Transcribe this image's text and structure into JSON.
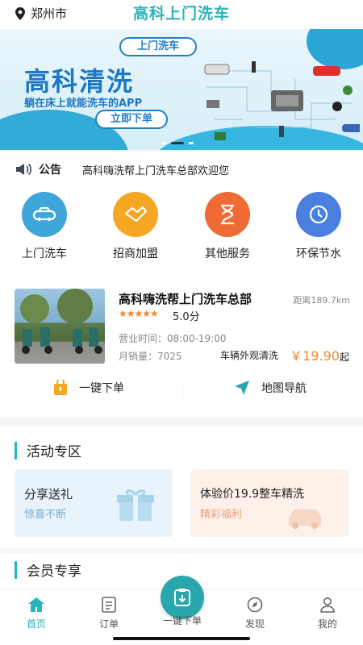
{
  "header": {
    "location": "郑州市",
    "title": "高科上门洗车"
  },
  "banner": {
    "tag": "上门洗车",
    "title": "高科清洗",
    "subtitle": "躺在床上就能洗车的APP",
    "cta": "立即下单"
  },
  "notice": {
    "label": "公告",
    "text": "高科嗨洗帮上门洗车总部欢迎您"
  },
  "quick_menu": [
    {
      "label": "上门洗车",
      "icon": "car-icon",
      "color": "#3fa6d9"
    },
    {
      "label": "招商加盟",
      "icon": "handshake-icon",
      "color": "#f5a623"
    },
    {
      "label": "其他服务",
      "icon": "hourglass-icon",
      "color": "#f06a35"
    },
    {
      "label": "环保节水",
      "icon": "clock-icon",
      "color": "#4a7fe0"
    }
  ],
  "store": {
    "name": "高科嗨洗帮上门洗车总部",
    "distance": "距离189.7km",
    "rating_stars": 5,
    "rating": "5.0分",
    "hours": "营业时间：08:00-19:00",
    "sales": "月销量：7025",
    "service": "车辆外观清洗",
    "price": "￥19.90",
    "price_suffix": "起"
  },
  "store_actions": {
    "order": "一键下单",
    "navigate": "地图导航"
  },
  "activity": {
    "title": "活动专区",
    "cards": [
      {
        "title": "分享送礼",
        "subtitle": "惊喜不断"
      },
      {
        "title": "体验价19.9整车精洗",
        "subtitle": "精彩福利"
      }
    ]
  },
  "member": {
    "title": "会员专享"
  },
  "tabbar": [
    {
      "label": "首页",
      "icon": "home-icon",
      "active": true
    },
    {
      "label": "订单",
      "icon": "order-icon",
      "active": false
    },
    {
      "label": "一键下单",
      "icon": "quick-order-icon",
      "active": false
    },
    {
      "label": "发现",
      "icon": "compass-icon",
      "active": false
    },
    {
      "label": "我的",
      "icon": "user-icon",
      "active": false
    }
  ],
  "colors": {
    "brand": "#2ab3b8",
    "price": "#f4862f",
    "banner_blue": "#1c78c5"
  }
}
